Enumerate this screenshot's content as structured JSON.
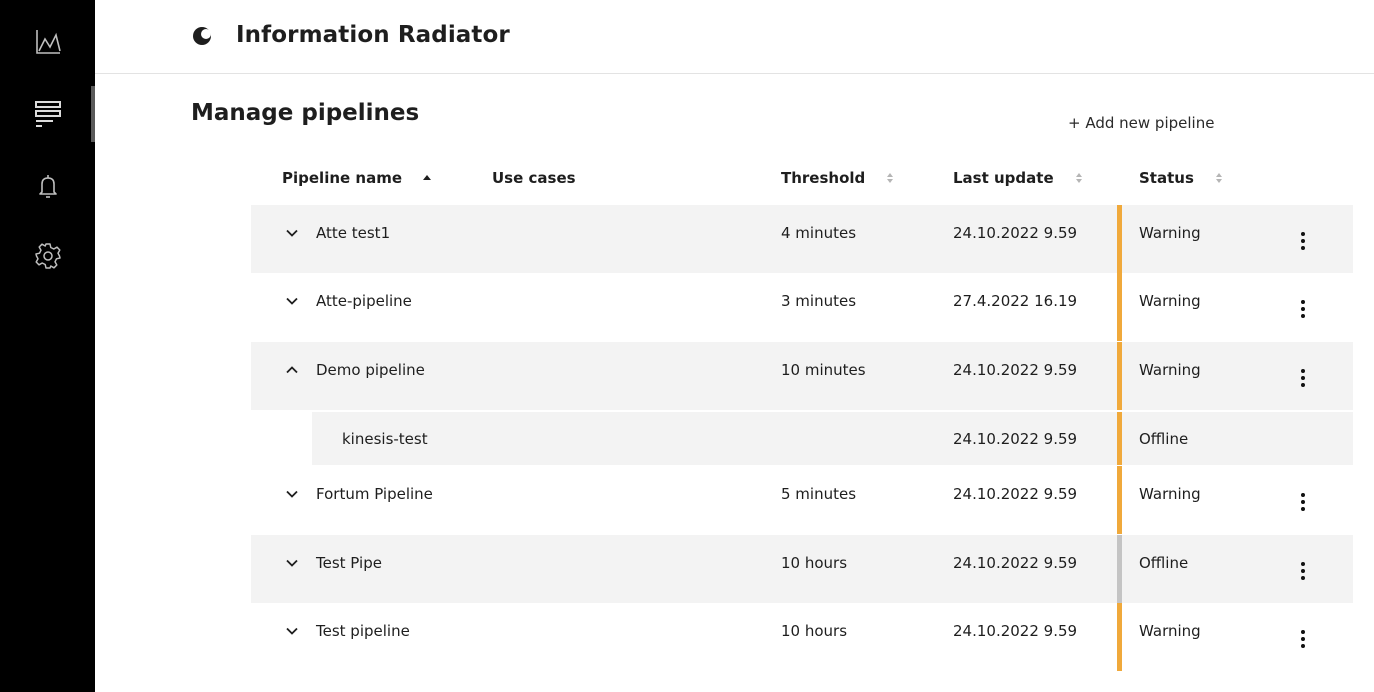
{
  "app": {
    "title": "Information Radiator"
  },
  "sidebar": {
    "items": [
      {
        "name": "analytics",
        "icon": "line-chart-icon"
      },
      {
        "name": "pipelines",
        "icon": "list-icon",
        "active": true
      },
      {
        "name": "notifications",
        "icon": "bell-icon"
      },
      {
        "name": "settings",
        "icon": "gear-icon"
      }
    ]
  },
  "page": {
    "title": "Manage pipelines",
    "add_label": "+ Add new pipeline"
  },
  "table": {
    "columns": {
      "name": "Pipeline name",
      "use_cases": "Use cases",
      "threshold": "Threshold",
      "last_update": "Last update",
      "status": "Status"
    },
    "rows": [
      {
        "name": "Atte test1",
        "threshold": "4 minutes",
        "last_update": "24.10.2022 9.59",
        "status": "Warning",
        "expanded": false
      },
      {
        "name": "Atte-pipeline",
        "threshold": "3 minutes",
        "last_update": "27.4.2022 16.19",
        "status": "Warning",
        "expanded": false
      },
      {
        "name": "Demo pipeline",
        "threshold": "10 minutes",
        "last_update": "24.10.2022 9.59",
        "status": "Warning",
        "expanded": true
      },
      {
        "name": "kinesis-test",
        "threshold": "",
        "last_update": "24.10.2022 9.59",
        "status": "Offline",
        "child": true
      },
      {
        "name": "Fortum Pipeline",
        "threshold": "5 minutes",
        "last_update": "24.10.2022 9.59",
        "status": "Warning",
        "expanded": false
      },
      {
        "name": "Test Pipe",
        "threshold": "10 hours",
        "last_update": "24.10.2022 9.59",
        "status": "Offline",
        "expanded": false
      },
      {
        "name": "Test pipeline",
        "threshold": "10 hours",
        "last_update": "24.10.2022 9.59",
        "status": "Warning",
        "expanded": false
      }
    ]
  },
  "colors": {
    "warning": "#f0a93b",
    "offline": "#c4c4c4",
    "row_shade": "#f3f3f3",
    "sidebar": "#000000"
  }
}
